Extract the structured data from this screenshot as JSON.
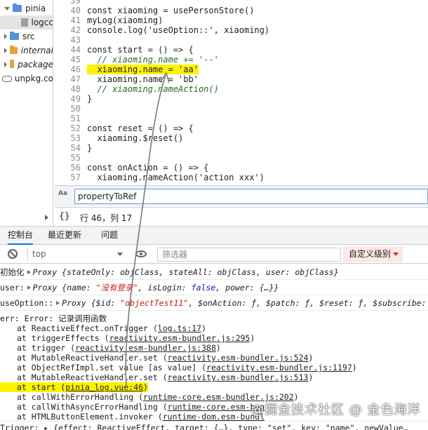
{
  "sidebar": {
    "items": [
      {
        "label": "pinia",
        "kind": "folder-blue",
        "expanded": true
      },
      {
        "label": "logcc",
        "kind": "file",
        "selected": true
      },
      {
        "label": "src",
        "kind": "folder-blue",
        "expanded": false
      },
      {
        "label": "internal",
        "kind": "folder-orange",
        "expanded": false
      },
      {
        "label": "package",
        "kind": "folder-orange",
        "expanded": false
      },
      {
        "label": "unpkg.co",
        "kind": "cloud",
        "expanded": false
      }
    ]
  },
  "editor": {
    "lines": [
      {
        "n": "39",
        "text": ""
      },
      {
        "n": "40",
        "text": "const xiaoming = usePersonStore()"
      },
      {
        "n": "41",
        "text": "myLog(xiaoming)"
      },
      {
        "n": "42",
        "text": "console.log('useOption::', xiaoming)"
      },
      {
        "n": "43",
        "text": ""
      },
      {
        "n": "44",
        "text": "const start = () => {"
      },
      {
        "n": "45",
        "text": "  // xiaoming.name += '--'"
      },
      {
        "n": "46",
        "text": "  xiaoming.name = 'aa'"
      },
      {
        "n": "47",
        "text": "  xiaoming.name = 'bb'"
      },
      {
        "n": "48",
        "text": "  // xiaoming.nameAction()"
      },
      {
        "n": "49",
        "text": "}"
      },
      {
        "n": "50",
        "text": ""
      },
      {
        "n": "51",
        "text": ""
      },
      {
        "n": "52",
        "text": "const reset = () => {"
      },
      {
        "n": "53",
        "text": "  xiaoming.$reset()"
      },
      {
        "n": "54",
        "text": "}"
      },
      {
        "n": "55",
        "text": ""
      },
      {
        "n": "56",
        "text": "const onAction = () => {"
      },
      {
        "n": "57",
        "text": "  xiaoming.nameAction('action xxx')"
      }
    ]
  },
  "search": {
    "value": "propertyToRef",
    "match_case_label": "Aa"
  },
  "status": {
    "cursor": "行 46，列 17",
    "braces": "{}"
  },
  "drawer": {
    "tabs": [
      "控制台",
      "最近更新",
      "问题"
    ]
  },
  "console_toolbar": {
    "context": "top",
    "filter_placeholder": "筛选器",
    "levels": "自定义级别"
  },
  "console": {
    "row1": {
      "prefix": "初始化",
      "sep": "",
      "body": "Proxy {stateOnly: objClass, stateAll: objClass, user: objClass}"
    },
    "row2": {
      "prefix": "user:",
      "body_a": "Proxy {name: ",
      "body_str": "\"没有登录\"",
      "body_b": ", isLogin: ",
      "body_kw": "false",
      "body_c": ", power: {…}}"
    },
    "row3": {
      "prefix": "useOption::",
      "body_a": "Proxy {$id: ",
      "body_str": "\"objectTest11\"",
      "body_b": ", $onAction: ƒ, $patch: ƒ, $reset: ƒ, $subscribe: ƒ, $…"
    },
    "err_head": "err: Error: 记录调用函数",
    "frames": [
      {
        "fn": "at ReactiveEffect.onTrigger (",
        "loc": "log.ts:17",
        "end": ")"
      },
      {
        "fn": "at triggerEffects (",
        "loc": "reactivity.esm-bundler.js:295",
        "end": ")"
      },
      {
        "fn": "at trigger (",
        "loc": "reactivity.esm-bundler.js:388",
        "end": ")"
      },
      {
        "fn": "at MutableReactiveHandler.set (",
        "loc": "reactivity.esm-bundler.js:524",
        "end": ")"
      },
      {
        "fn": "at ObjectRefImpl.set value [as value] (",
        "loc": "reactivity.esm-bundler.js:1197",
        "end": ")"
      },
      {
        "fn": "at MutableReactiveHandler.set (",
        "loc": "reactivity.esm-bundler.js:513",
        "end": ")"
      },
      {
        "fn": "at start (",
        "loc": "pinia_log.vue:46",
        "end": ")"
      },
      {
        "fn": "at callWithErrorHandling (",
        "loc": "runtime-core.esm-bundler.js:202",
        "end": ")"
      },
      {
        "fn": "at callWithAsyncErrorHandling (",
        "loc": "runtime-core.esm-bun",
        "end": ""
      },
      {
        "fn": "at HTMLButtonElement.invoker (",
        "loc": "runtime-dom.esm-bundl",
        "end": ""
      }
    ],
    "last_row": "Trigger: ▸ {effect: ReactiveEffect, target: {…}, type: \"set\", key: \"name\", newValue…"
  },
  "watermark": "@掘金技术社区 @ 金色海洋",
  "colors": {
    "highlight": "#fff200",
    "accent": "#1a73e8",
    "comment": "#236e25",
    "string": "#c41a16"
  }
}
